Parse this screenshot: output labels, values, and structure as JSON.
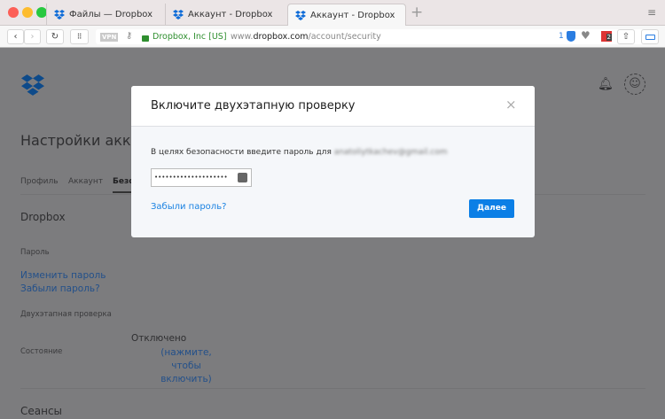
{
  "browser": {
    "tabs": [
      {
        "label": "Файлы — Dropbox"
      },
      {
        "label": "Аккаунт - Dropbox"
      },
      {
        "label": "Аккаунт - Dropbox",
        "active": true
      }
    ],
    "new_tab": "+",
    "vpn": "VPN",
    "site_identity": "Dropbox, Inc [US]",
    "url_prefix": "www.",
    "url_domain": "dropbox.com",
    "url_path": "/account/security",
    "badge_count": "1",
    "ext_badge": "2",
    "colors": {
      "secure": "#2f8f2f",
      "accent": "#0070e0"
    }
  },
  "page": {
    "title": "Настройки аккаунт",
    "tabs": [
      "Профиль",
      "Аккаунт",
      "Безо"
    ],
    "section_dropbox": "Dropbox",
    "password_label": "Пароль",
    "change_password": "Изменить пароль",
    "forgot_password": "Забыли пароль?",
    "two_step_label": "Двухэтапная проверка",
    "status_label": "Состояние",
    "status_value": "Отключено",
    "enable_link_1": "(нажмите, чтобы",
    "enable_link_2": "включить)",
    "sessions": "Сеансы"
  },
  "modal": {
    "title": "Включите двухэтапную проверку",
    "close": "×",
    "prompt": "В целях безопасности введите пароль для",
    "email": "anatoliytkachev@gmail.com",
    "password_value": "••••••••••••••••••••",
    "forgot": "Забыли пароль?",
    "next": "Далее"
  }
}
